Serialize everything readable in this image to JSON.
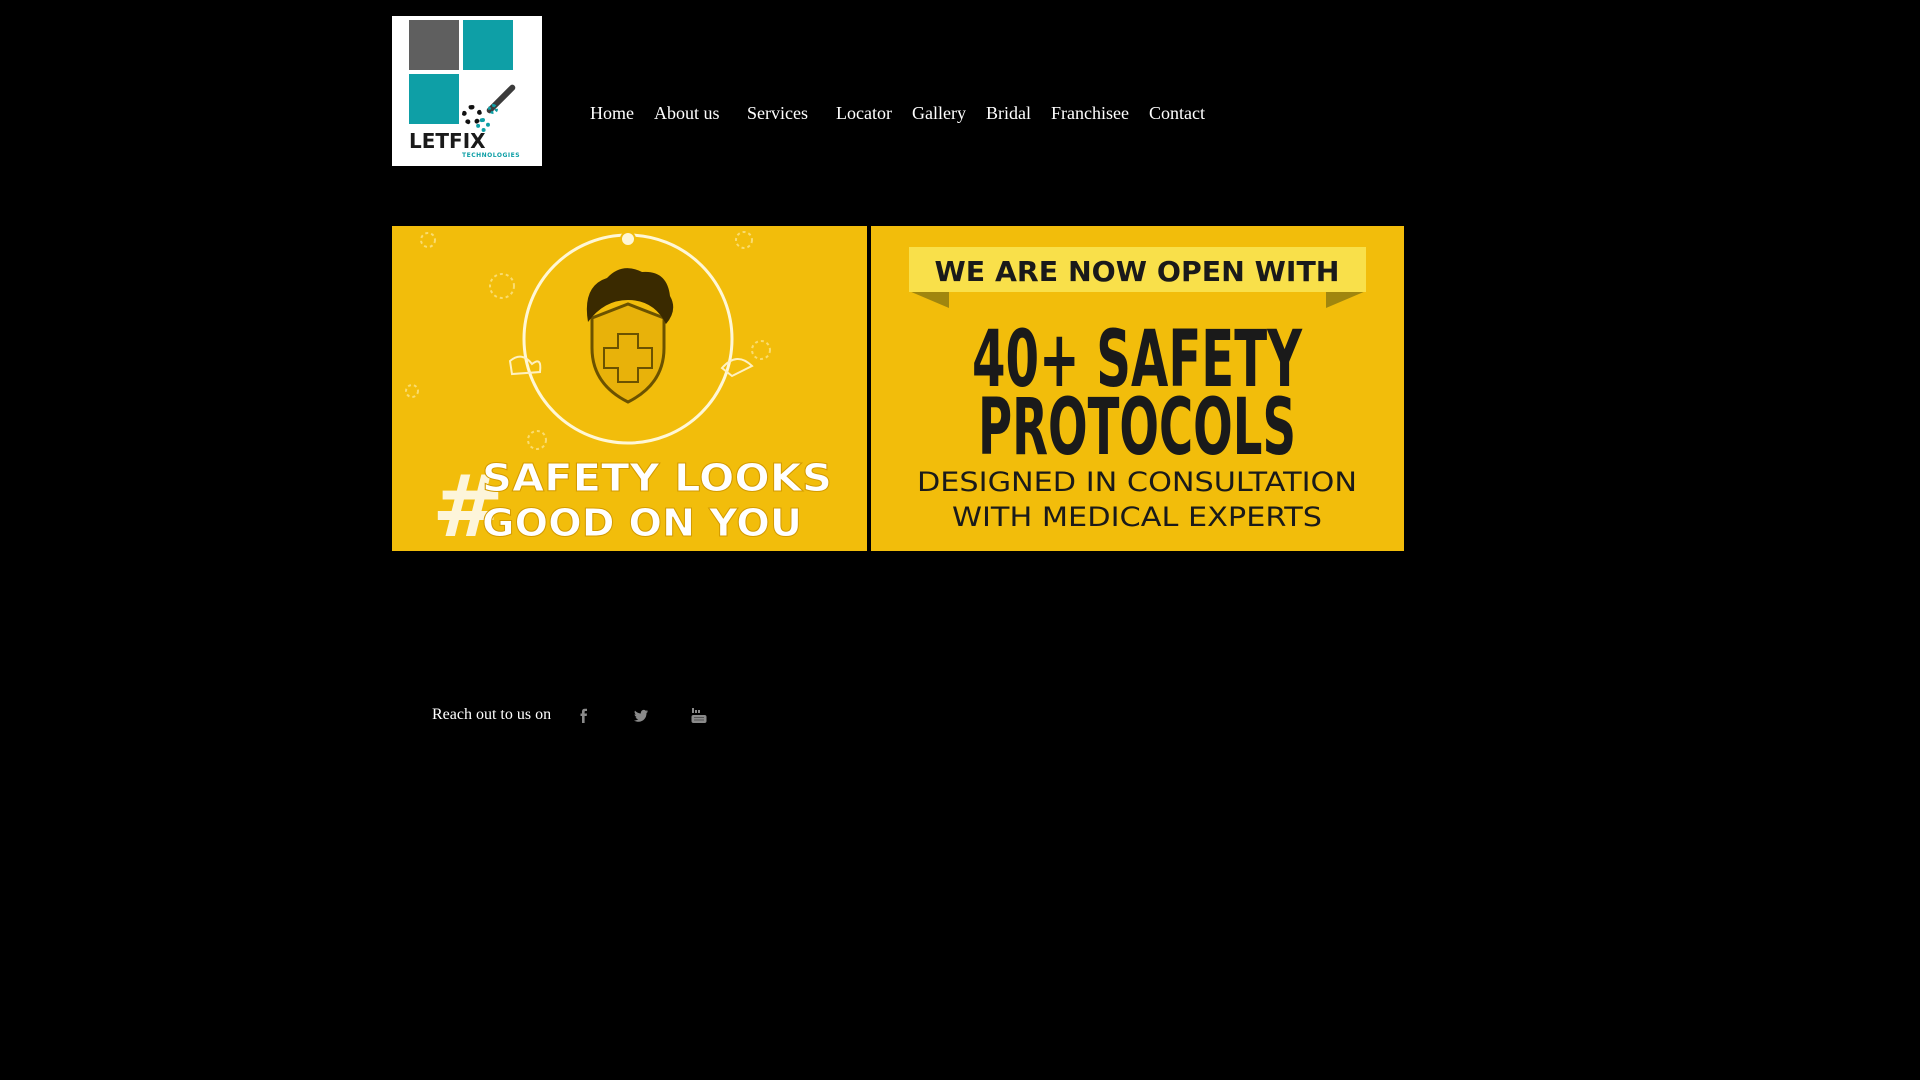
{
  "header": {
    "logo": {
      "brand_text": "LETFIX",
      "tagline": "TECHNOLOGIES"
    },
    "nav": [
      {
        "label": "Home"
      },
      {
        "label": "About us"
      },
      {
        "label": "Services"
      },
      {
        "label": "Locator"
      },
      {
        "label": "Gallery"
      },
      {
        "label": "Bridal"
      },
      {
        "label": "Franchisee"
      },
      {
        "label": "Contact"
      }
    ]
  },
  "banners": {
    "left": {
      "text": "#SAFETY LOOKS GOOD ON YOU",
      "line1": "SAFETY LOOKS",
      "line2": "GOOD ON YOU",
      "hash": "#"
    },
    "right": {
      "ribbon": "WE ARE NOW OPEN WITH",
      "headline1": "40+ SAFETY",
      "headline2": "PROTOCOLS",
      "sub1": "DESIGNED IN CONSULTATION",
      "sub2": "WITH MEDICAL EXPERTS"
    }
  },
  "footer": {
    "social_label": "Reach out to us on",
    "icons": [
      "facebook-icon",
      "twitter-icon",
      "youtube-icon"
    ]
  },
  "colors": {
    "background": "#000000",
    "banner_yellow": "#f2bd0b",
    "ribbon_yellow": "#f9e04a",
    "logo_teal": "#0e9fa6",
    "logo_gray": "#5f5f5f",
    "icon_gray": "#8a8a8a"
  }
}
